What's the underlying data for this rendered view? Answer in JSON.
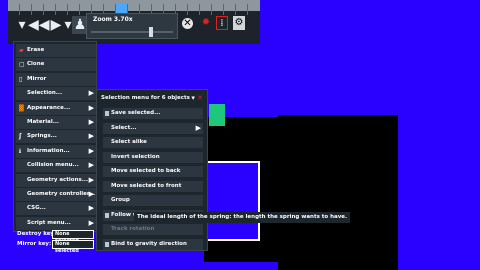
{
  "toolbar": {
    "zoom_label": "Zoom 3.70x",
    "zoom_level": 3.7
  },
  "side_menu": {
    "items": [
      {
        "label": "Erase",
        "icon": "eraser-icon"
      },
      {
        "label": "Clone",
        "icon": "clone-icon"
      },
      {
        "label": "Mirror",
        "icon": "mirror-icon"
      },
      {
        "label": "Selection...",
        "icon": ""
      },
      {
        "label": "Appearance...",
        "icon": "palette-icon"
      },
      {
        "label": "Material...",
        "icon": ""
      },
      {
        "label": "Springs...",
        "icon": "spring-icon"
      },
      {
        "label": "Information...",
        "icon": "info-icon"
      },
      {
        "label": "Collision menu...",
        "icon": ""
      },
      {
        "label": "Geometry actions...",
        "icon": ""
      },
      {
        "label": "Geometry controller...",
        "icon": ""
      },
      {
        "label": "CSG...",
        "icon": ""
      },
      {
        "label": "Script menu...",
        "icon": ""
      }
    ],
    "destroy_key_label": "Destroy key:",
    "destroy_key_value": "None selected",
    "mirror_key_label": "Mirror key:",
    "mirror_key_value": "None selected"
  },
  "popup": {
    "title": "Selection menu for 6 objects",
    "items": [
      {
        "label": "Save selected...",
        "dim": false
      },
      {
        "label": "Select...",
        "dim": false
      },
      {
        "label": "Select alike",
        "dim": false
      },
      {
        "label": "Invert selection",
        "dim": false
      },
      {
        "label": "Move selected to back",
        "dim": false
      },
      {
        "label": "Move selected to front",
        "dim": false
      },
      {
        "label": "Group",
        "dim": false
      },
      {
        "label": "Follow w",
        "dim": false
      },
      {
        "label": "Track rotation",
        "dim": true
      },
      {
        "label": "Bind to gravity direction",
        "dim": false
      }
    ]
  },
  "tooltip": "The ideal length of the spring: the length the spring wants to have.",
  "status_corner": "1.0"
}
